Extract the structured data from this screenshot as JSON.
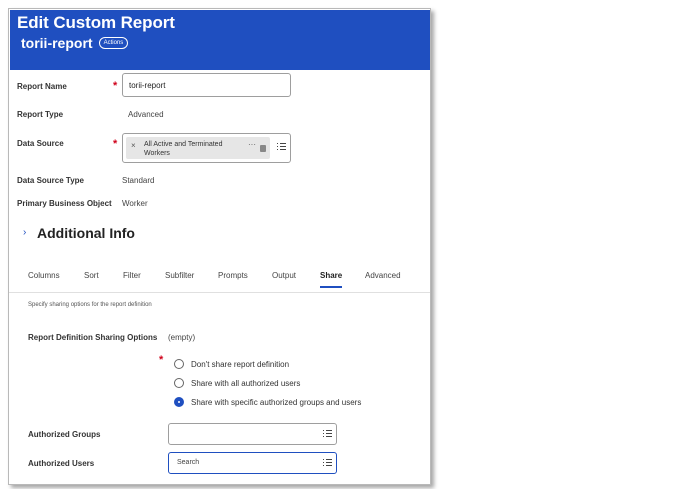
{
  "header": {
    "title": "Edit Custom Report",
    "subtitle": "torii-report",
    "actions_label": "Actions"
  },
  "fields": {
    "report_name": {
      "label": "Report Name",
      "value": "torii-report"
    },
    "report_type": {
      "label": "Report Type",
      "value": "Advanced"
    },
    "data_source": {
      "label": "Data Source",
      "selected": "All Active and Terminated Workers"
    },
    "data_source_type": {
      "label": "Data Source Type",
      "value": "Standard"
    },
    "primary_business_object": {
      "label": "Primary Business Object",
      "value": "Worker"
    }
  },
  "section": {
    "title": "Additional Info"
  },
  "tabs": [
    {
      "label": "Columns"
    },
    {
      "label": "Sort"
    },
    {
      "label": "Filter"
    },
    {
      "label": "Subfilter"
    },
    {
      "label": "Prompts"
    },
    {
      "label": "Output"
    },
    {
      "label": "Share",
      "active": true
    },
    {
      "label": "Advanced"
    }
  ],
  "share": {
    "hint": "Specify sharing options for the report definition",
    "options_label": "Report Definition Sharing Options",
    "options_value": "(empty)",
    "radios": [
      {
        "label": "Don't share report definition",
        "selected": false
      },
      {
        "label": "Share with all authorized users",
        "selected": false
      },
      {
        "label": "Share with specific authorized groups and users",
        "selected": true
      }
    ],
    "authorized_groups_label": "Authorized Groups",
    "authorized_users_label": "Authorized Users",
    "search_placeholder": "Search"
  },
  "colors": {
    "header_bg": "#1f4fc0",
    "required": "#d0021b",
    "accent": "#1f4fc0"
  },
  "icons": {
    "remove": "close-icon",
    "more": "ellipsis-icon",
    "prompt": "list-icon",
    "expand": "chevron-right-icon"
  }
}
